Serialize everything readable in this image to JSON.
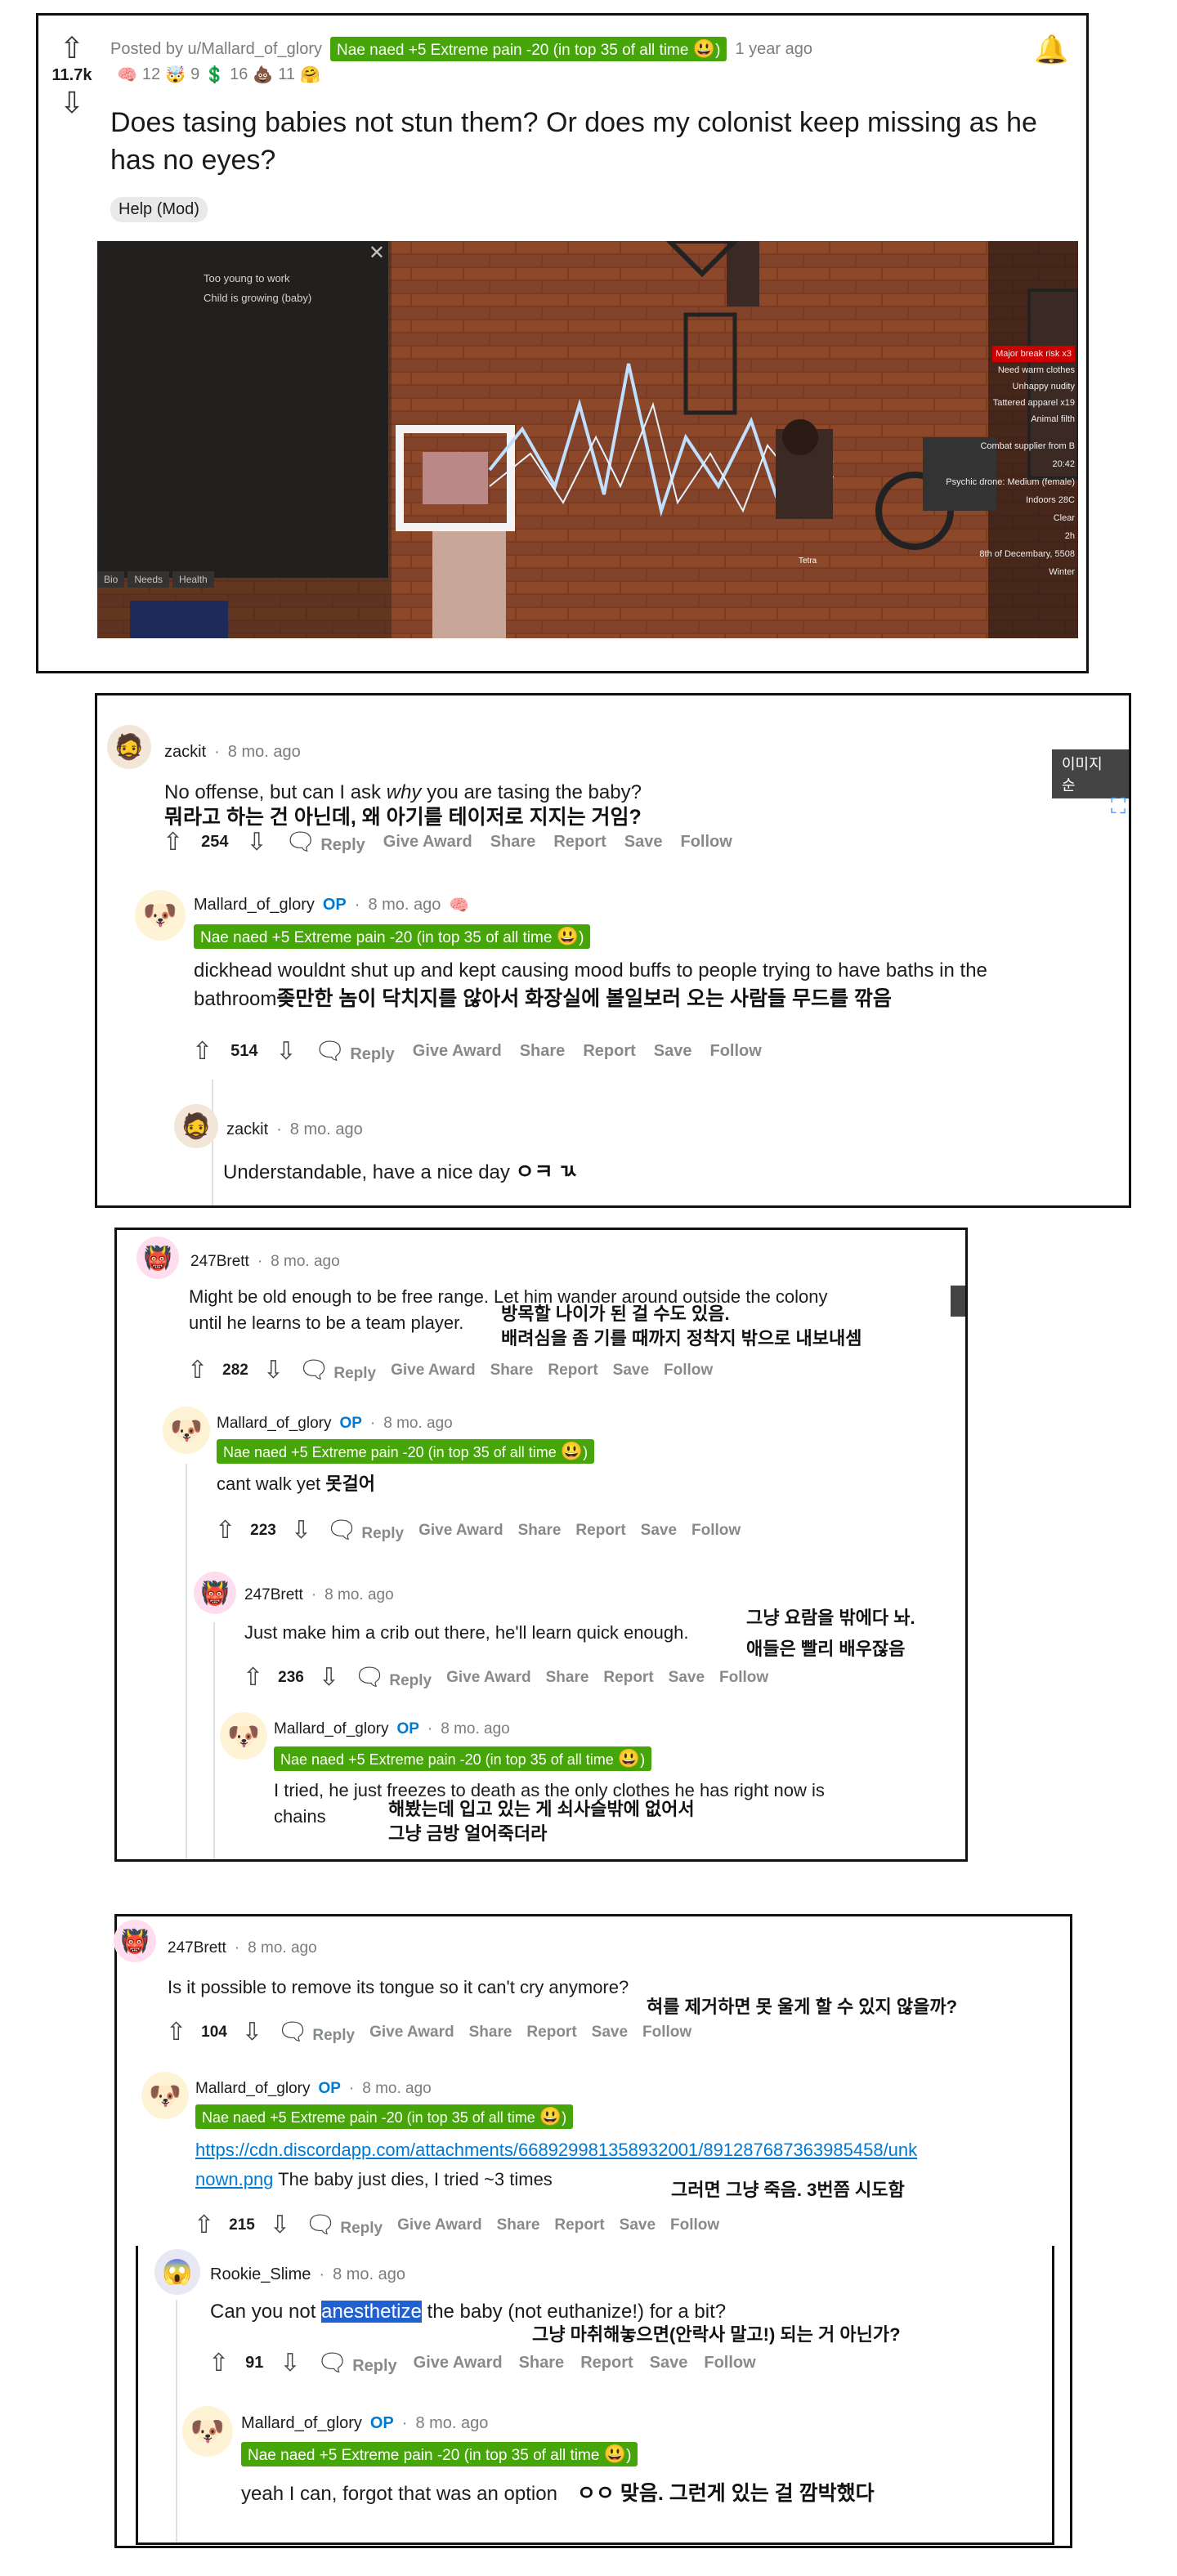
{
  "post": {
    "score": "11.7k",
    "posted_by": "Posted by u/Mallard_of_glory",
    "flair": "Nae naed +5 Extreme pain -20 (in top 35 of all time",
    "time": "1 year ago",
    "awards": [
      "12",
      "9",
      "16",
      "11"
    ],
    "title": "Does tasing babies not stun them? Or does my colonist keep missing as he has no eyes?",
    "tag": "Help (Mod)",
    "game_panel": {
      "needs_lines": [
        "Too young to work",
        "Child is growing (baby)"
      ],
      "tabs": [
        "Bio",
        "Needs",
        "Health"
      ],
      "status_lines": [
        "Major break risk x3",
        "Need warm clothes",
        "Unhappy nudity",
        "Tattered apparel x19",
        "Animal filth"
      ],
      "info_lines": [
        "Combat supplier from B",
        "20:42",
        "Psychic drone: Medium (female)",
        "Indoors 28C",
        "Clear",
        "2h",
        "8th of Decembary, 5508",
        "Winter"
      ],
      "pawn_tag": "Tetra"
    }
  },
  "block1": {
    "zackit": {
      "author": "zackit",
      "time": "8 mo. ago",
      "text_before": "No offense, but can I ask ",
      "text_em": "why",
      "text_after": " you are tasing the baby?",
      "kr": "뭐라고 하는 건 아닌데, 왜 아기를 테이저로 지지는 거임?",
      "votes": "254"
    },
    "mallard": {
      "author": "Mallard_of_glory",
      "op": "OP",
      "time": "8 mo. ago",
      "flair": "Nae naed +5 Extreme pain -20 (in top 35 of all time",
      "text_line1": "dickhead wouldnt shut up and kept causing mood buffs to people trying to have baths in the",
      "text_line2": "bathroom",
      "kr": "좆만한 놈이 닥치지를 않아서 화장실에 볼일보러 오는 사람들 무드를 깎음",
      "votes": "514"
    },
    "zackit2": {
      "author": "zackit",
      "time": "8 mo. ago",
      "text": "Understandable, have a nice day",
      "kr": "ㅇㅋ ㄳ"
    },
    "side_label": "이미지 순"
  },
  "block2": {
    "brett1": {
      "author": "247Brett",
      "time": "8 mo. ago",
      "text_line1": "Might be old enough to be free range. Let him wander around outside the colony",
      "text_line2": "until he learns to be a team player.",
      "kr1": "방목할 나이가 된 걸 수도 있음.",
      "kr2": "배려심을 좀 기를 때까지 정착지 밖으로 내보내셈",
      "votes": "282"
    },
    "mallard1": {
      "author": "Mallard_of_glory",
      "op": "OP",
      "time": "8 mo. ago",
      "flair": "Nae naed +5 Extreme pain -20 (in top 35 of all time",
      "text": "cant walk yet",
      "kr": "못걸어",
      "votes": "223"
    },
    "brett2": {
      "author": "247Brett",
      "time": "8 mo. ago",
      "text": "Just make him a crib out there, he'll learn quick enough.",
      "kr1": "그냥 요람을 밖에다 놔.",
      "kr2": "애들은 빨리 배우잖음",
      "votes": "236"
    },
    "mallard2": {
      "author": "Mallard_of_glory",
      "op": "OP",
      "time": "8 mo. ago",
      "flair": "Nae naed +5 Extreme pain -20 (in top 35 of all time",
      "text_line1": "I tried, he just freezes to death as the only clothes he has right now is",
      "text_line2": "chains",
      "kr1": "해봤는데 입고 있는 게 쇠사슬밖에 없어서",
      "kr2": "그냥 금방 얼어죽더라"
    }
  },
  "block3": {
    "brett": {
      "author": "247Brett",
      "time": "8 mo. ago",
      "text": "Is it possible to remove its tongue so it can't cry anymore?",
      "kr": "혀를 제거하면 못 울게 할 수 있지 않을까?",
      "votes": "104"
    },
    "mallard1": {
      "author": "Mallard_of_glory",
      "op": "OP",
      "time": "8 mo. ago",
      "flair": "Nae naed +5 Extreme pain -20 (in top 35 of all time",
      "link_line1": "https://cdn.discordapp.com/attachments/668929981358932001/891287687363985458/unk",
      "link_line2": "nown.png",
      "text_after": " The baby just dies, I tried ~3 times",
      "kr": "그러면 그냥 죽음. 3번쯤 시도함",
      "votes": "215"
    },
    "rookie": {
      "author": "Rookie_Slime",
      "time": "8 mo. ago",
      "text_before": "Can you not ",
      "text_hl": "anesthetize",
      "text_after": " the baby (not euthanize!) for a bit?",
      "kr": "그냥 마취해놓으면(안락사 말고!) 되는 거 아닌가?",
      "votes": "91"
    },
    "mallard2": {
      "author": "Mallard_of_glory",
      "op": "OP",
      "time": "8 mo. ago",
      "flair": "Nae naed +5 Extreme pain -20 (in top 35 of all time",
      "text": "yeah I can, forgot that was an option",
      "kr": "ㅇㅇ 맞음. 그런게 있는 걸 깜박했다"
    }
  },
  "actions": {
    "reply": "Reply",
    "give_award": "Give Award",
    "share": "Share",
    "report": "Report",
    "save": "Save",
    "follow": "Follow"
  },
  "icons": {
    "upvote": "upvote-arrow-icon",
    "downvote": "downvote-arrow-icon",
    "comment": "comment-bubble-icon",
    "bell": "bell-icon"
  },
  "colors": {
    "flair_green": "#46a508",
    "op_blue": "#0079d3",
    "link_blue": "#0079d3"
  }
}
